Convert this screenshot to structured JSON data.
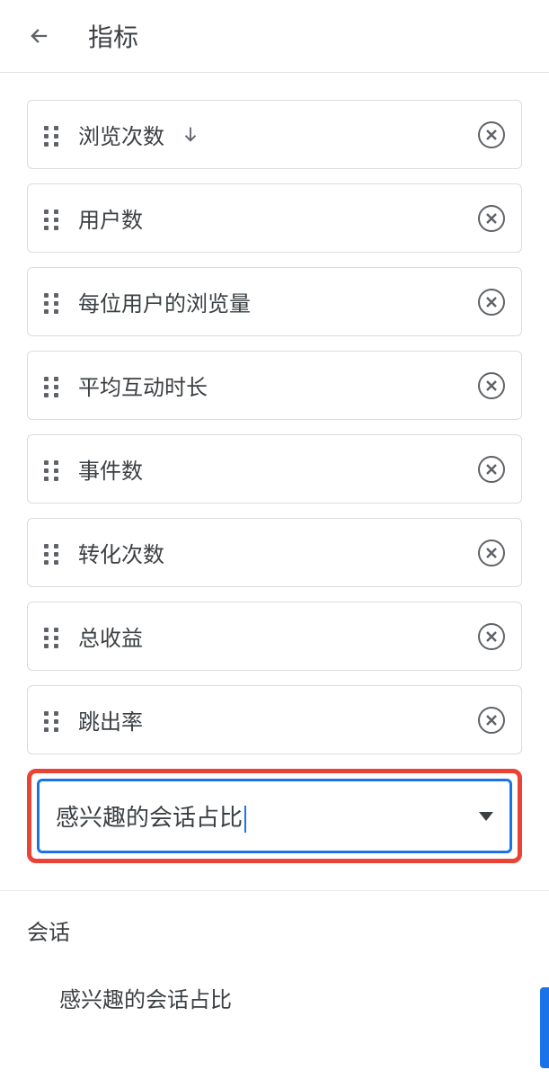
{
  "header": {
    "title": "指标"
  },
  "metrics": [
    {
      "label": "浏览次数",
      "sorted": true
    },
    {
      "label": "用户数",
      "sorted": false
    },
    {
      "label": "每位用户的浏览量",
      "sorted": false
    },
    {
      "label": "平均互动时长",
      "sorted": false
    },
    {
      "label": "事件数",
      "sorted": false
    },
    {
      "label": "转化次数",
      "sorted": false
    },
    {
      "label": "总收益",
      "sorted": false
    },
    {
      "label": "跳出率",
      "sorted": false
    }
  ],
  "search": {
    "value": "感兴趣的会话占比"
  },
  "dropdown": {
    "category": "会话",
    "options": [
      "感兴趣的会话占比"
    ]
  }
}
